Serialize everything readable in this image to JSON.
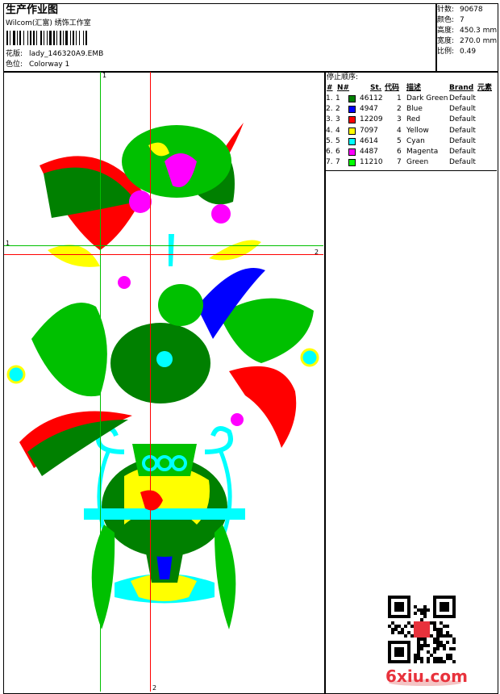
{
  "header": {
    "title": "生产作业图",
    "company": "Wilcom(汇富) 绣饰工作室",
    "design_label": "花版:",
    "design_value": "lady_146320A9.EMB",
    "colorway_label": "色位:",
    "colorway_value": "Colorway 1"
  },
  "info": {
    "stitches_label": "针数:",
    "stitches_value": "90678",
    "colors_label": "颜色:",
    "colors_value": "7",
    "height_label": "高度:",
    "height_value": "450.3 mm",
    "width_label": "宽度:",
    "width_value": "270.0 mm",
    "scale_label": "比例:",
    "scale_value": "0.49"
  },
  "stop_sequence": {
    "title": "停止顺序:",
    "headers": [
      "#",
      "N#",
      "St.",
      "代码",
      "描述",
      "Brand",
      "元素"
    ],
    "rows": [
      {
        "idx": "1.",
        "n": "1",
        "color": "#008000",
        "st": "46112",
        "code": "1",
        "desc": "Dark Green",
        "brand": "Default"
      },
      {
        "idx": "2.",
        "n": "2",
        "color": "#0000ff",
        "st": "4947",
        "code": "2",
        "desc": "Blue",
        "brand": "Default"
      },
      {
        "idx": "3.",
        "n": "3",
        "color": "#ff0000",
        "st": "12209",
        "code": "3",
        "desc": "Red",
        "brand": "Default"
      },
      {
        "idx": "4.",
        "n": "4",
        "color": "#ffff00",
        "st": "7097",
        "code": "4",
        "desc": "Yellow",
        "brand": "Default"
      },
      {
        "idx": "5.",
        "n": "5",
        "color": "#00ffff",
        "st": "4614",
        "code": "5",
        "desc": "Cyan",
        "brand": "Default"
      },
      {
        "idx": "6.",
        "n": "6",
        "color": "#ff00ff",
        "st": "4487",
        "code": "6",
        "desc": "Magenta",
        "brand": "Default"
      },
      {
        "idx": "7.",
        "n": "7",
        "color": "#00ff00",
        "st": "11210",
        "code": "7",
        "desc": "Green",
        "brand": "Default"
      }
    ]
  },
  "guides": {
    "v_green": "1",
    "v_red": "2",
    "h_green": "1",
    "h_red": "2"
  },
  "watermark": {
    "text": "6xiu.com"
  },
  "colors": {
    "green_guide": "#00c000",
    "red_guide": "#ff0000"
  }
}
